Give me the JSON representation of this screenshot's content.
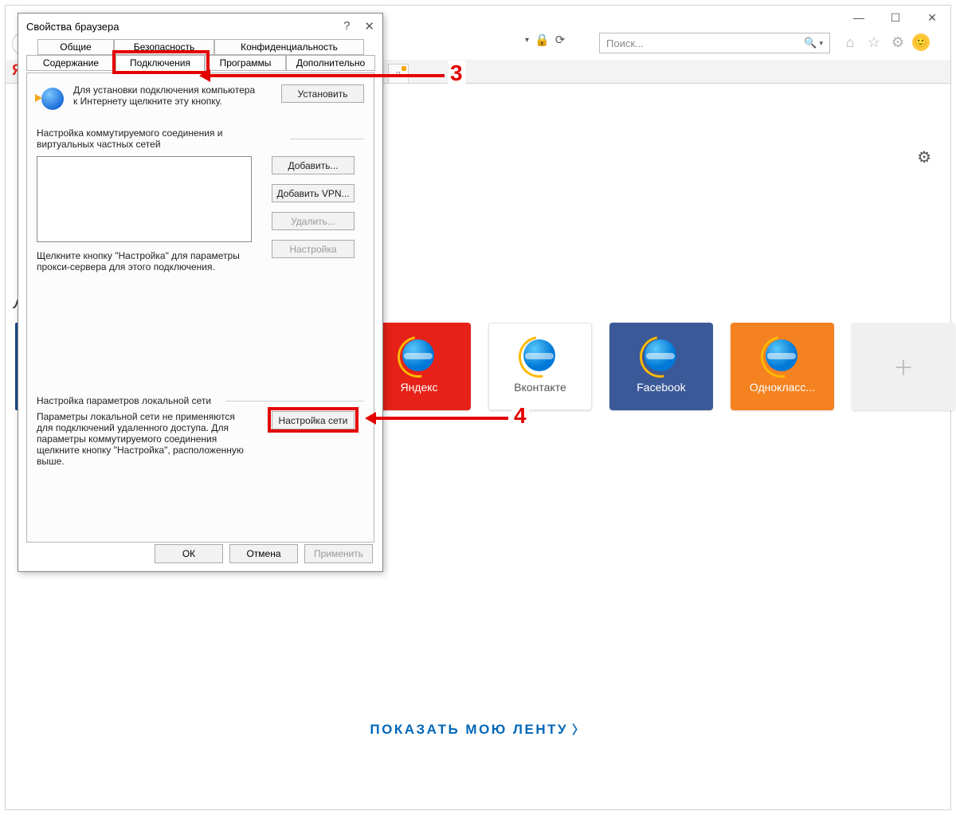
{
  "browser": {
    "search_placeholder": "Поиск...",
    "yandex_logo_letter": "Я",
    "page_letter": "Л",
    "show_feed": "ПОКАЗАТЬ МОЮ ЛЕНТУ",
    "tiles": [
      {
        "label": "Яндекс",
        "color": "red"
      },
      {
        "label": "Вконтакте",
        "color": "white"
      },
      {
        "label": "Facebook",
        "color": "blue"
      },
      {
        "label": "Однокласс...",
        "color": "orange"
      }
    ]
  },
  "dialog": {
    "title": "Свойства браузера",
    "tabs_row1": [
      "Общие",
      "Безопасность",
      "Конфиденциальность"
    ],
    "tabs_row2": [
      "Содержание",
      "Подключения",
      "Программы",
      "Дополнительно"
    ],
    "install_text": "Для установки подключения компьютера к Интернету щелкните эту кнопку.",
    "install_btn": "Установить",
    "dialup_header": "Настройка коммутируемого соединения и виртуальных частных сетей",
    "add_btn": "Добавить...",
    "add_vpn_btn": "Добавить VPN...",
    "delete_btn": "Удалить...",
    "settings_btn": "Настройка",
    "proxy_hint": "Щелкните кнопку \"Настройка\" для параметры прокси-сервера для этого подключения.",
    "lan_header": "Настройка параметров локальной сети",
    "lan_text": "Параметры локальной сети не применяются для подключений удаленного доступа. Для параметры коммутируемого соединения щелкните кнопку \"Настройка\", расположенную выше.",
    "lan_btn": "Настройка сети",
    "ok": "ОК",
    "cancel": "Отмена",
    "apply": "Применить"
  },
  "annotations": {
    "num3": "3",
    "num4": "4"
  }
}
